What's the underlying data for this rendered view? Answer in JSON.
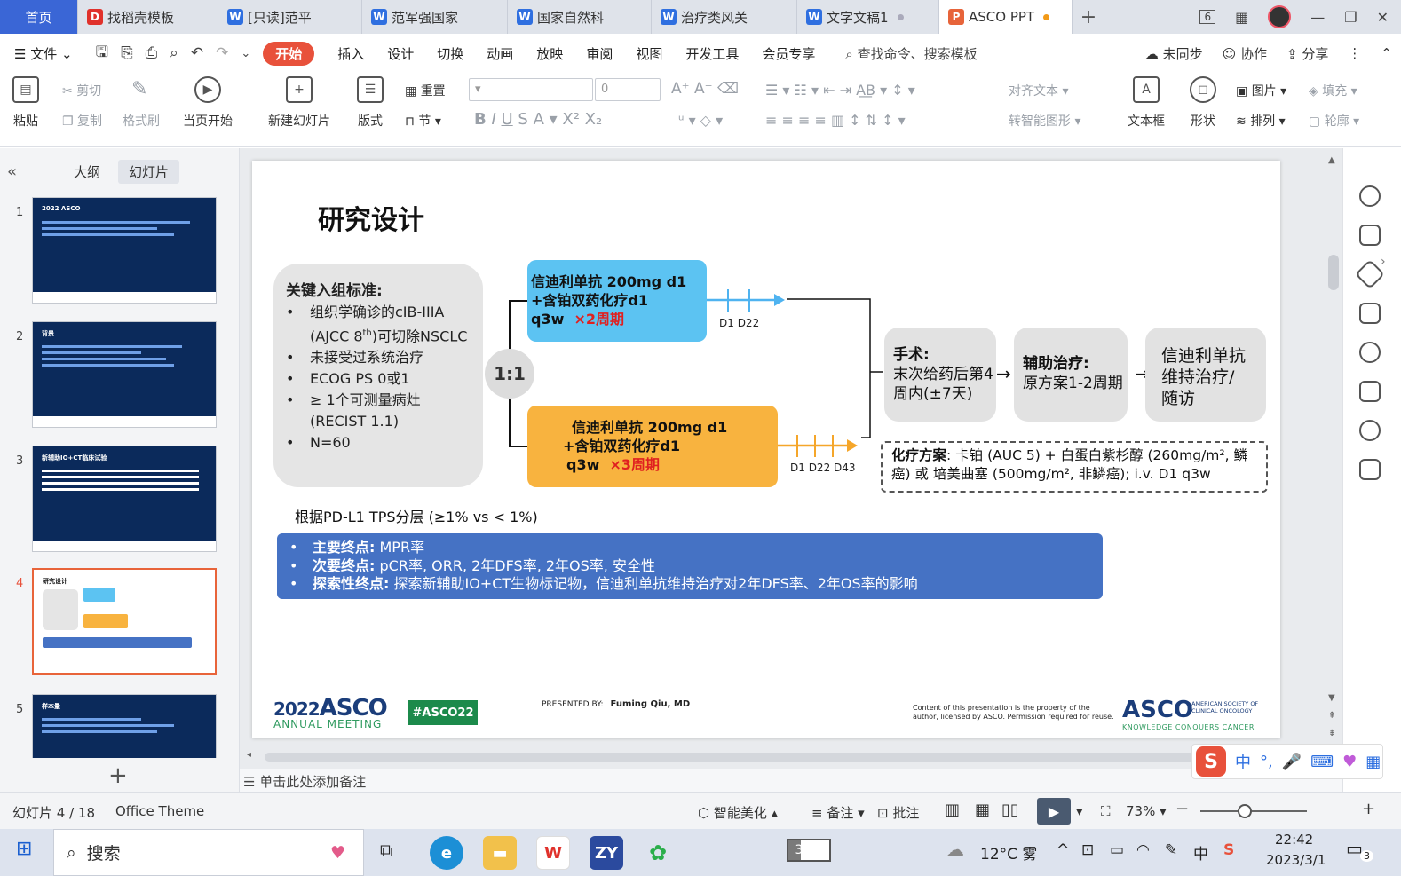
{
  "tabs": [
    {
      "label": "首页",
      "icon": "home",
      "active": false
    },
    {
      "label": "找稻壳模板",
      "icon": "docer-icon",
      "active": false
    },
    {
      "label": "[只读]范平",
      "icon": "word-icon",
      "active": false
    },
    {
      "label": "范军强国家",
      "icon": "word-icon",
      "active": false
    },
    {
      "label": "国家自然科",
      "icon": "word-icon",
      "active": false
    },
    {
      "label": "治疗类风关",
      "icon": "word-icon",
      "active": false
    },
    {
      "label": "文字文稿1",
      "icon": "word-icon",
      "active": false
    },
    {
      "label": "ASCO PPT",
      "icon": "ppt-icon",
      "active": true
    }
  ],
  "window_badge": "6",
  "menu": {
    "file": "文件",
    "start": "开始",
    "items": [
      "插入",
      "设计",
      "切换",
      "动画",
      "放映",
      "审阅",
      "视图",
      "开发工具",
      "会员专享"
    ],
    "search": "查找命令、搜索模板",
    "unsynced": "未同步",
    "collab": "协作",
    "share": "分享"
  },
  "ribbon": {
    "paste": "粘贴",
    "cut": "剪切",
    "copy": "复制",
    "format_painter": "格式刷",
    "from_current": "当页开始",
    "new_slide": "新建幻灯片",
    "layout": "版式",
    "reset": "重置",
    "section": "节",
    "font_size": "0",
    "align_text": "对齐文本",
    "smart_art": "转智能图形",
    "textbox": "文本框",
    "shape": "形状",
    "picture": "图片",
    "fill": "填充",
    "arrange": "排列",
    "outline": "轮廓"
  },
  "left_panel": {
    "outline_tab": "大纲",
    "slides_tab": "幻灯片",
    "thumbnails": [
      {
        "num": "1",
        "title": "2022 ASCO"
      },
      {
        "num": "2",
        "title": "背景"
      },
      {
        "num": "3",
        "title": "新辅助IO+CT临床试验"
      },
      {
        "num": "4",
        "title": "研究设计"
      },
      {
        "num": "5",
        "title": "样本量"
      }
    ],
    "current": 4
  },
  "slide": {
    "title": "研究设计",
    "criteria_heading": "关键入组标准:",
    "criteria": [
      {
        "text": "组织学确诊的cIB-IIIA",
        "bullet": true
      },
      {
        "text": "(AJCC 8th)可切除NSCLC",
        "bullet": false
      },
      {
        "text": "未接受过系统治疗",
        "bullet": true
      },
      {
        "text": "ECOG PS 0或1",
        "bullet": true
      },
      {
        "text": "≥ 1个可测量病灶",
        "bullet": true
      },
      {
        "text": "(RECIST 1.1)",
        "bullet": false
      },
      {
        "text": "N=60",
        "bullet": true
      }
    ],
    "ratio": "1:1",
    "arm_a": {
      "line1": "信迪利单抗 200mg d1",
      "line2": "+含铂双药化疗d1",
      "line3": "q3w",
      "cycles": "×2周期",
      "days": "D1   D22"
    },
    "arm_b": {
      "line1": "信迪利单抗 200mg d1",
      "line2": "+含铂双药化疗d1",
      "line3": "q3w",
      "cycles": "×3周期",
      "days": "D1  D22  D43"
    },
    "surgery": {
      "title": "手术:",
      "line1": "末次给药后第4",
      "line2": "周内(±7天)"
    },
    "adjuvant": {
      "title": "辅助治疗:",
      "line1": "原方案1-2周期"
    },
    "maintenance": {
      "line1": "信迪利单抗",
      "line2": "维持治疗/",
      "line3": "随访"
    },
    "chemo_label": "化疗方案",
    "chemo_line1": ": 卡铂 (AUC 5) + 白蛋白紫杉醇 (260mg/m², 鳞",
    "chemo_line2": "癌) 或 培美曲塞 (500mg/m², 非鳞癌); i.v. D1 q3w",
    "stratification": "根据PD-L1 TPS分层 (≥1% vs < 1%)",
    "endpoints": [
      {
        "label": "主要终点:",
        "text": " MPR率"
      },
      {
        "label": "次要终点:",
        "text": " pCR率, ORR, 2年DFS率, 2年OS率, 安全性"
      },
      {
        "label": "探索性终点:",
        "text": " 探索新辅助IO+CT生物标记物，信迪利单抗维持治疗对2年DFS率、2年OS率的影响"
      }
    ],
    "footer": {
      "logo_year": "2022",
      "logo_name": "ASCO",
      "logo_sub": "ANNUAL MEETING",
      "hashtag": "#ASCO22",
      "presented_by": "PRESENTED BY:",
      "presenter": "Fuming Qiu, MD",
      "copyright_1": "Content of this presentation is the property of the",
      "copyright_2": "author, licensed by ASCO. Permission required for reuse.",
      "asco_right": "ASCO",
      "asco_side_1": "AMERICAN SOCIETY OF",
      "asco_side_2": "CLINICAL ONCOLOGY",
      "asco_tagline": "KNOWLEDGE CONQUERS CANCER"
    }
  },
  "notes_placeholder": "单击此处添加备注",
  "ime": {
    "mode": "中"
  },
  "status": {
    "slide_pos": "幻灯片 4 / 18",
    "theme": "Office Theme",
    "beautify": "智能美化",
    "notes": "备注",
    "comments": "批注",
    "zoom": "73%",
    "zoom_level": 0.42
  },
  "taskbar": {
    "search": "搜索",
    "battery": "30%",
    "battery_level": 0.3,
    "weather": "12°C  雾",
    "time": "22:42",
    "date": "2023/3/1",
    "notify_count": "3",
    "input_lang": "中"
  },
  "colors": {
    "accent": "#e8513b",
    "home_tab": "#3a66d6",
    "arm_a": "#5cc3f2",
    "arm_b": "#f8b33f",
    "endpoints": "#4572c4",
    "asco_blue": "#1b3d7a",
    "asco_green": "#1c8a4b"
  }
}
